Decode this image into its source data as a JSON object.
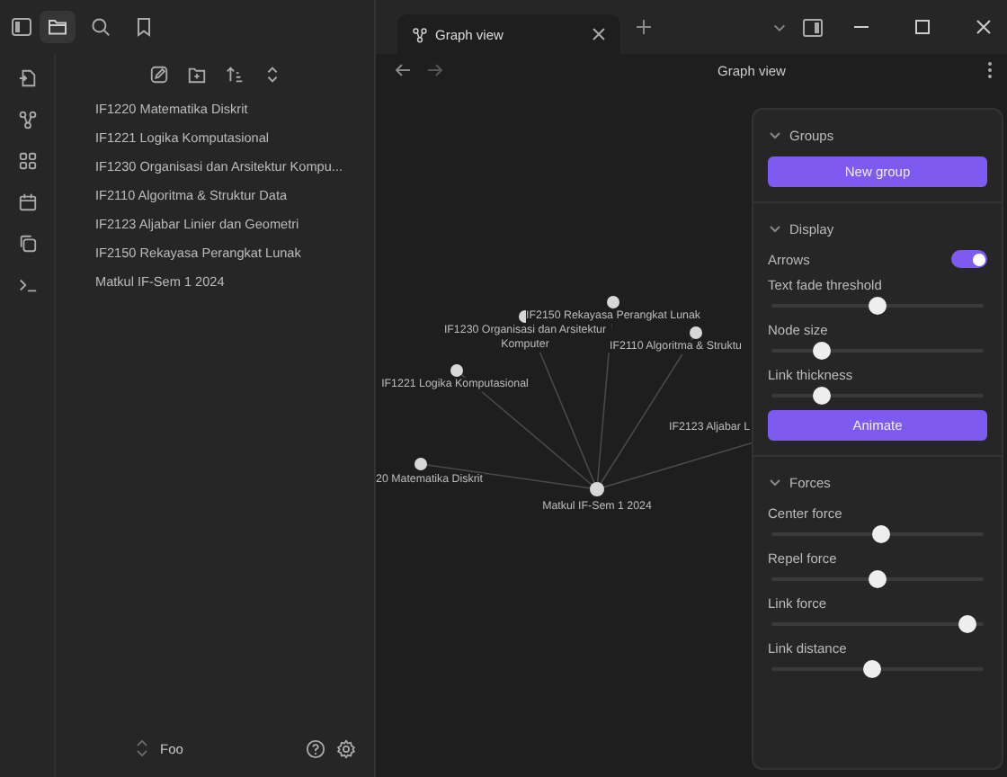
{
  "sidebar_tabs": [
    {
      "kind": "files",
      "selected": true
    },
    {
      "kind": "search",
      "selected": false
    },
    {
      "kind": "bookmarks",
      "selected": false
    }
  ],
  "file_list": [
    {
      "label": "IF1220 Matematika Diskrit"
    },
    {
      "label": "IF1221 Logika Komputasional"
    },
    {
      "label": "IF1230 Organisasi dan Arsitektur Kompu..."
    },
    {
      "label": "IF2110 Algoritma & Struktur Data"
    },
    {
      "label": "IF2123 Aljabar Linier dan Geometri"
    },
    {
      "label": "IF2150 Rekayasa Perangkat Lunak"
    },
    {
      "label": "Matkul IF-Sem 1 2024"
    }
  ],
  "vault": {
    "name": "Foo"
  },
  "tabs": [
    {
      "title": "Graph view",
      "selected": true
    }
  ],
  "view_header": {
    "title": "Graph view"
  },
  "graph": {
    "nodes": [
      {
        "label": "IF2150 Rekayasa Perangkat Lunak",
        "kind": "note"
      },
      {
        "label": "IF1230 Organisasi dan Arsitektur Komputer",
        "kind": "note"
      },
      {
        "label": "IF2110 Algoritma & Struktu",
        "kind": "note"
      },
      {
        "label": "IF1221 Logika Komputasional",
        "kind": "note"
      },
      {
        "label": "IF2123 Aljabar L",
        "kind": "hidden"
      },
      {
        "label": "20 Matematika Diskrit",
        "kind": "note"
      },
      {
        "label": "Matkul IF-Sem 1 2024",
        "kind": "hub"
      }
    ]
  },
  "settings": [
    {
      "title": "Groups",
      "expanded": true,
      "controls": [
        {
          "kind": "button",
          "label": "New group"
        }
      ]
    },
    {
      "title": "Display",
      "expanded": true,
      "controls": [
        {
          "kind": "toggle",
          "label": "Arrows",
          "on": true
        },
        {
          "kind": "slider",
          "label": "Text fade threshold",
          "level": 0.5
        },
        {
          "kind": "slider",
          "label": "Node size",
          "level": 0.21
        },
        {
          "kind": "slider",
          "label": "Link thickness",
          "level": 0.21
        },
        {
          "kind": "button",
          "label": "Animate"
        }
      ]
    },
    {
      "title": "Forces",
      "expanded": true,
      "controls": [
        {
          "kind": "slider",
          "label": "Center force",
          "level": 0.52
        },
        {
          "kind": "slider",
          "label": "Repel force",
          "level": 0.5
        },
        {
          "kind": "slider",
          "label": "Link force",
          "level": 0.96
        },
        {
          "kind": "slider",
          "label": "Link distance",
          "level": 0.47
        }
      ]
    }
  ]
}
